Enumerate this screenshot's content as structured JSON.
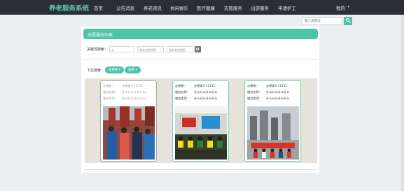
{
  "nav": {
    "brand": "养老服务系统",
    "items": [
      "首页",
      "公告消息",
      "养老资讯",
      "休闲娱乐",
      "医疗健康",
      "志愿服务",
      "出游服务",
      "申请护工"
    ],
    "user": "我的"
  },
  "search": {
    "placeholder": "输入关键词"
  },
  "section": {
    "title": "志愿服务列表"
  },
  "filter": {
    "keyword_label": "关键词搜索：",
    "inputs": [
      "志",
      "服务名称搜索",
      "服务类型搜索"
    ]
  },
  "sort": {
    "label": "下拉搜索：",
    "options": [
      "志愿者",
      "排序"
    ]
  },
  "cards": [
    {
      "rows": [
        [
          "志愿者:",
          "志愿者1-11111"
        ],
        [
          "服务名称:",
          "什么什么什么什么.."
        ],
        [
          "服务类型:",
          "什么什么什么什么.."
        ]
      ]
    },
    {
      "rows": [
        [
          "志愿者:",
          "志愿者1-11111"
        ],
        [
          "服务名称:",
          "什么什么什么什么"
        ],
        [
          "服务类型:",
          "什么什么什么什么"
        ]
      ]
    },
    {
      "rows": [
        [
          "志愿者:",
          "志愿者1-11111"
        ],
        [
          "服务名称:",
          "什么什么什么什么"
        ],
        [
          "服务类型:",
          "什么什么什么什么"
        ]
      ]
    }
  ],
  "colors": {
    "accent": "#4fc3a6",
    "nav_bg": "#2b2f33",
    "brand": "#5ec8b0"
  }
}
